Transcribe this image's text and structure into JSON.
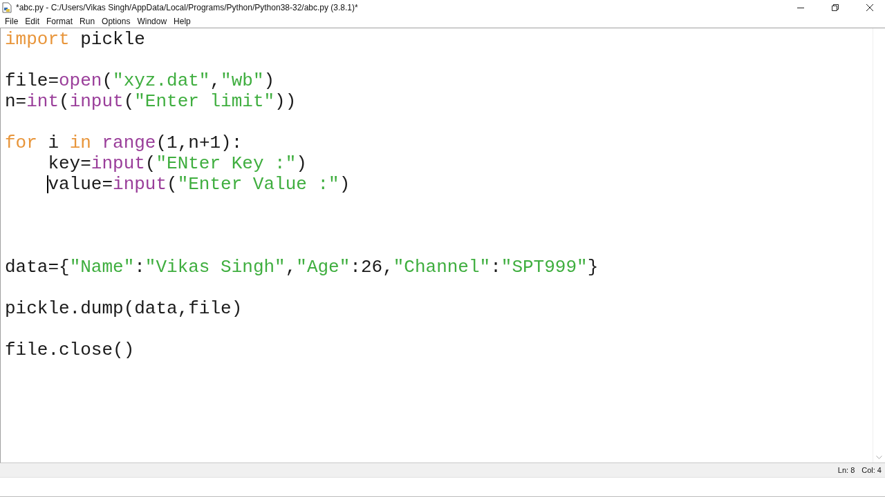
{
  "window": {
    "title": "*abc.py - C:/Users/Vikas Singh/AppData/Local/Programs/Python/Python38-32/abc.py (3.8.1)*"
  },
  "menu": [
    "File",
    "Edit",
    "Format",
    "Run",
    "Options",
    "Window",
    "Help"
  ],
  "editor": {
    "lines": [
      {
        "kind": "code",
        "cursor": false,
        "tokens": [
          {
            "text": "import",
            "kind": "keyword"
          },
          {
            "text": " pickle",
            "kind": "plain"
          }
        ]
      },
      {
        "kind": "blank"
      },
      {
        "kind": "code",
        "cursor": false,
        "tokens": [
          {
            "text": "file=",
            "kind": "plain"
          },
          {
            "text": "open",
            "kind": "builtin"
          },
          {
            "text": "(",
            "kind": "plain"
          },
          {
            "text": "\"xyz.dat\"",
            "kind": "string"
          },
          {
            "text": ",",
            "kind": "plain"
          },
          {
            "text": "\"wb\"",
            "kind": "string"
          },
          {
            "text": ")",
            "kind": "plain"
          }
        ]
      },
      {
        "kind": "code",
        "cursor": false,
        "tokens": [
          {
            "text": "n=",
            "kind": "plain"
          },
          {
            "text": "int",
            "kind": "builtin"
          },
          {
            "text": "(",
            "kind": "plain"
          },
          {
            "text": "input",
            "kind": "builtin"
          },
          {
            "text": "(",
            "kind": "plain"
          },
          {
            "text": "\"Enter limit\"",
            "kind": "string"
          },
          {
            "text": "))",
            "kind": "plain"
          }
        ]
      },
      {
        "kind": "blank"
      },
      {
        "kind": "code",
        "cursor": false,
        "tokens": [
          {
            "text": "for",
            "kind": "keyword"
          },
          {
            "text": " i ",
            "kind": "plain"
          },
          {
            "text": "in",
            "kind": "keyword"
          },
          {
            "text": " range",
            "kind": "builtin"
          },
          {
            "text": "(1,n+1):",
            "kind": "plain"
          }
        ]
      },
      {
        "kind": "code",
        "cursor": false,
        "indent": true,
        "tokens": [
          {
            "text": "key=",
            "kind": "plain"
          },
          {
            "text": "input",
            "kind": "builtin"
          },
          {
            "text": "(",
            "kind": "plain"
          },
          {
            "text": "\"ENter Key :\"",
            "kind": "string"
          },
          {
            "text": ")",
            "kind": "plain"
          }
        ]
      },
      {
        "kind": "code",
        "cursor": true,
        "indent": true,
        "tokens": [
          {
            "text": "value=",
            "kind": "plain"
          },
          {
            "text": "input",
            "kind": "builtin"
          },
          {
            "text": "(",
            "kind": "plain"
          },
          {
            "text": "\"Enter Value :\"",
            "kind": "string"
          },
          {
            "text": ")",
            "kind": "plain"
          }
        ]
      },
      {
        "kind": "blank"
      },
      {
        "kind": "blank"
      },
      {
        "kind": "blank"
      },
      {
        "kind": "code",
        "cursor": false,
        "tokens": [
          {
            "text": "data={",
            "kind": "plain"
          },
          {
            "text": "\"Name\"",
            "kind": "string"
          },
          {
            "text": ":",
            "kind": "plain"
          },
          {
            "text": "\"Vikas Singh\"",
            "kind": "string"
          },
          {
            "text": ",",
            "kind": "plain"
          },
          {
            "text": "\"Age\"",
            "kind": "string"
          },
          {
            "text": ":26,",
            "kind": "plain"
          },
          {
            "text": "\"Channel\"",
            "kind": "string"
          },
          {
            "text": ":",
            "kind": "plain"
          },
          {
            "text": "\"SPT999\"",
            "kind": "string"
          },
          {
            "text": "}",
            "kind": "plain"
          }
        ]
      },
      {
        "kind": "blank"
      },
      {
        "kind": "code",
        "cursor": false,
        "tokens": [
          {
            "text": "pickle.dump(data,file)",
            "kind": "plain"
          }
        ]
      },
      {
        "kind": "blank"
      },
      {
        "kind": "code",
        "cursor": false,
        "tokens": [
          {
            "text": "file.close()",
            "kind": "plain"
          }
        ]
      }
    ]
  },
  "status_bar": {
    "line": "Ln: 8",
    "column": "Col: 4"
  }
}
